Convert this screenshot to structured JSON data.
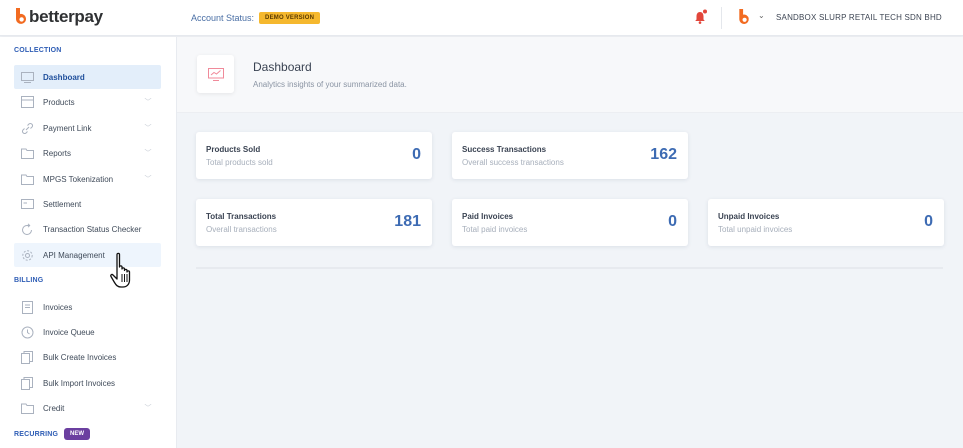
{
  "brand": {
    "name": "betterpay"
  },
  "header": {
    "account_status_label": "Account Status:",
    "account_status_badge": "DEMO VERSION",
    "org_name": "SANDBOX SLURP RETAIL TECH SDN BHD",
    "accent_color": "#f5b82e"
  },
  "sidebar": {
    "sections": {
      "collection": "COLLECTION",
      "billing": "BILLING",
      "recurring": "RECURRING",
      "recurring_badge": "NEW"
    },
    "collection_items": [
      {
        "label": "Dashboard",
        "icon": "dashboard-icon",
        "active": true
      },
      {
        "label": "Products",
        "icon": "box-icon",
        "has_children": true
      },
      {
        "label": "Payment Link",
        "icon": "link-icon",
        "has_children": true
      },
      {
        "label": "Reports",
        "icon": "folder-icon",
        "has_children": true
      },
      {
        "label": "MPGS Tokenization",
        "icon": "folder-icon",
        "has_children": true
      },
      {
        "label": "Settlement",
        "icon": "card-icon"
      },
      {
        "label": "Transaction Status Checker",
        "icon": "refresh-icon"
      },
      {
        "label": "API Management",
        "icon": "gear-icon",
        "hovered": true
      }
    ],
    "billing_items": [
      {
        "label": "Invoices",
        "icon": "document-icon"
      },
      {
        "label": "Invoice Queue",
        "icon": "clock-icon"
      },
      {
        "label": "Bulk Create Invoices",
        "icon": "copy-icon"
      },
      {
        "label": "Bulk Import Invoices",
        "icon": "copy-icon"
      },
      {
        "label": "Credit",
        "icon": "folder-icon",
        "has_children": true
      }
    ]
  },
  "page": {
    "title": "Dashboard",
    "subtitle": "Analytics insights of your summarized data."
  },
  "stats": [
    {
      "title": "Products Sold",
      "subtitle": "Total products sold",
      "value": "0"
    },
    {
      "title": "Success Transactions",
      "subtitle": "Overall success transactions",
      "value": "162"
    },
    {
      "title": "Total Transactions",
      "subtitle": "Overall transactions",
      "value": "181"
    },
    {
      "title": "Paid Invoices",
      "subtitle": "Total paid invoices",
      "value": "0"
    },
    {
      "title": "Unpaid Invoices",
      "subtitle": "Total unpaid invoices",
      "value": "0"
    }
  ],
  "colors": {
    "primary": "#3d6bb3",
    "brand_orange": "#f26b21",
    "badge_purple": "#6b3fa0"
  }
}
